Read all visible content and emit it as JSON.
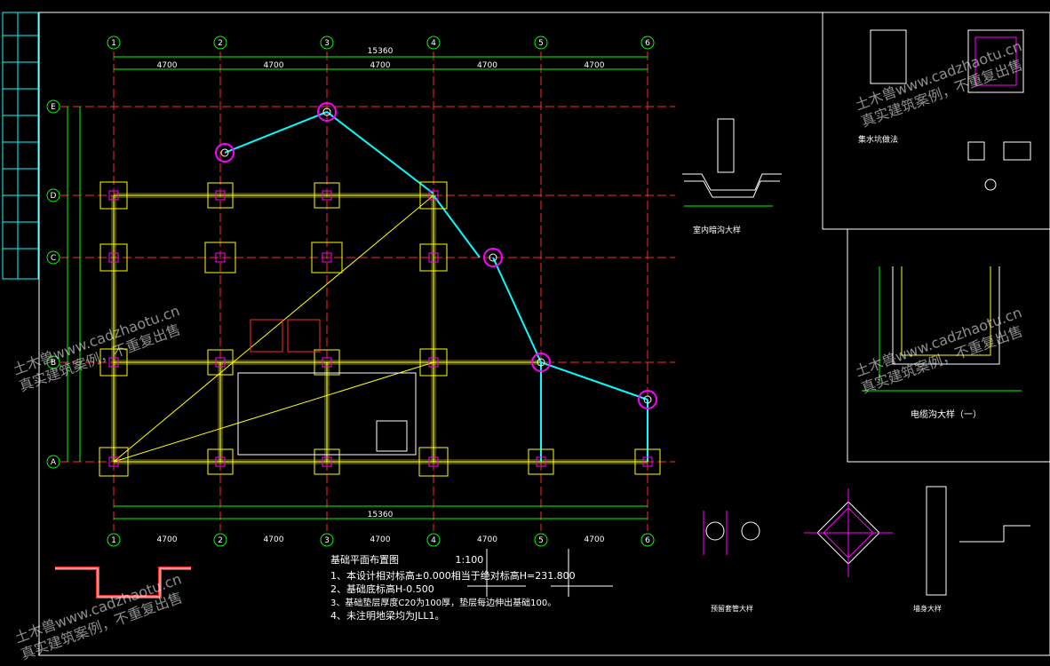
{
  "axes": {
    "columns": [
      "1",
      "2",
      "3",
      "4",
      "5",
      "6"
    ],
    "rows": [
      "E",
      "D",
      "C",
      "B",
      "A"
    ]
  },
  "dimensions": {
    "top_total": "15360",
    "bottom_total": "15360",
    "top_segments": [
      "4700",
      "4700",
      "4700",
      "4700",
      "4700"
    ],
    "bottom_segments": [
      "4700",
      "4700",
      "4700",
      "4700",
      "4700"
    ]
  },
  "plan": {
    "title": "基础平面布置图",
    "scale": "1:100",
    "notes": [
      "1、本设计相对标高±0.000相当于绝对标高H=231.800",
      "2、基础底标高H-0.500",
      "3、基础垫层厚度C20为100厚，垫层每边伸出基础100。",
      "4、未注明地梁均为JLL1。"
    ]
  },
  "details": {
    "indoor_trench": "室内暗沟大样",
    "cable_trench": "电缆沟大样（一）",
    "sump": "集水坑做法",
    "pipe_detail": "预留套管大样",
    "wall_detail": "墙身大样"
  },
  "watermark": {
    "site": "土木兽www.cadzhaotu.cn",
    "tagline": "真实建筑案例，不重复出售"
  },
  "colors": {
    "background": "#000000",
    "grid": "#ff2a2a",
    "beam": "#ffff00",
    "pile": "#00ffff",
    "dimension": "#00ff00",
    "frame": "#ffffff",
    "accent": "#ff00ff"
  }
}
